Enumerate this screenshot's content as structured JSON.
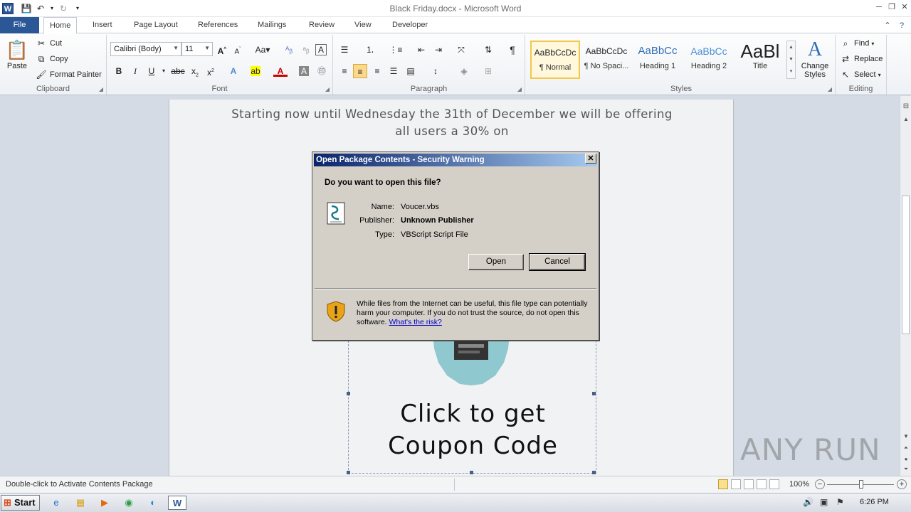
{
  "window": {
    "title": "Black Friday.docx  -  Microsoft Word"
  },
  "ribbon": {
    "tabs": [
      "File",
      "Home",
      "Insert",
      "Page Layout",
      "References",
      "Mailings",
      "Review",
      "View",
      "Developer"
    ],
    "clipboard": {
      "label": "Clipboard",
      "paste": "Paste",
      "cut": "Cut",
      "copy": "Copy",
      "format_painter": "Format Painter"
    },
    "font": {
      "label": "Font",
      "family": "Calibri (Body)",
      "size": "11"
    },
    "paragraph": {
      "label": "Paragraph"
    },
    "styles": {
      "label": "Styles",
      "items": [
        {
          "sample": "AaBbCcDc",
          "name": "¶ Normal"
        },
        {
          "sample": "AaBbCcDc",
          "name": "¶ No Spaci..."
        },
        {
          "sample": "AaBbCc",
          "name": "Heading 1"
        },
        {
          "sample": "AaBbCc",
          "name": "Heading 2"
        },
        {
          "sample": "AaBl",
          "name": "Title"
        }
      ],
      "change_styles": "Change Styles"
    },
    "editing": {
      "label": "Editing",
      "find": "Find",
      "replace": "Replace",
      "select": "Select"
    }
  },
  "document": {
    "line1": "Starting now until Wednesday the 31th of December we will be offering",
    "line2": "all users a 30% on",
    "coupon_line1": "Click to get",
    "coupon_line2": "Coupon Code"
  },
  "dialog": {
    "title": "Open Package Contents - Security Warning",
    "close_glyph": "✕",
    "question": "Do you want to open this file?",
    "name_label": "Name:",
    "name_value": "Voucer.vbs",
    "publisher_label": "Publisher:",
    "publisher_value": "Unknown Publisher",
    "type_label": "Type:",
    "type_value": "VBScript Script File",
    "open_button": "Open",
    "cancel_button": "Cancel",
    "warning_text": "While files from the Internet can be useful, this file type can potentially harm your computer. If you do not trust the source, do not open this software.",
    "warning_link": "What's the risk?"
  },
  "statusbar": {
    "text": "Double-click to Activate Contents Package",
    "zoom": "100%"
  },
  "taskbar": {
    "start": "Start",
    "clock": "6:26 PM"
  },
  "watermark": "ANY RUN",
  "colors": {
    "file_tab": "#2b5797",
    "dialog_title_start": "#0a246a",
    "dialog_face": "#d4d0c8"
  }
}
